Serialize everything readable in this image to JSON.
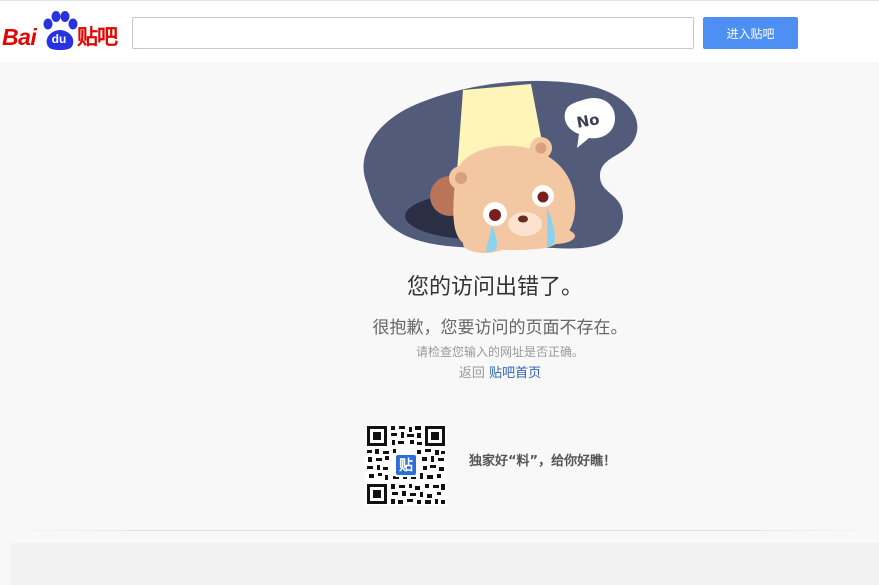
{
  "header": {
    "logo": {
      "bai": "Bai",
      "du": "du",
      "tieba": "贴吧"
    },
    "search": {
      "value": "",
      "placeholder": ""
    },
    "enter_button_label": "进入贴吧"
  },
  "illustration": {
    "speech_bubble_text": "No"
  },
  "error": {
    "title": "您的访问出错了。",
    "subtitle": "很抱歉，您要访问的页面不存在。",
    "hint": "请检查您输入的网址是否正确。",
    "return_prefix": "返回",
    "return_link_label": "贴吧首页"
  },
  "qr_promo": {
    "qr_badge": "贴",
    "text": "独家好“料”，给你好瞧！"
  },
  "colors": {
    "brand_red": "#e10602",
    "brand_blue": "#2932e1",
    "button_blue": "#4e8ff3",
    "link_blue": "#2d64b3"
  }
}
